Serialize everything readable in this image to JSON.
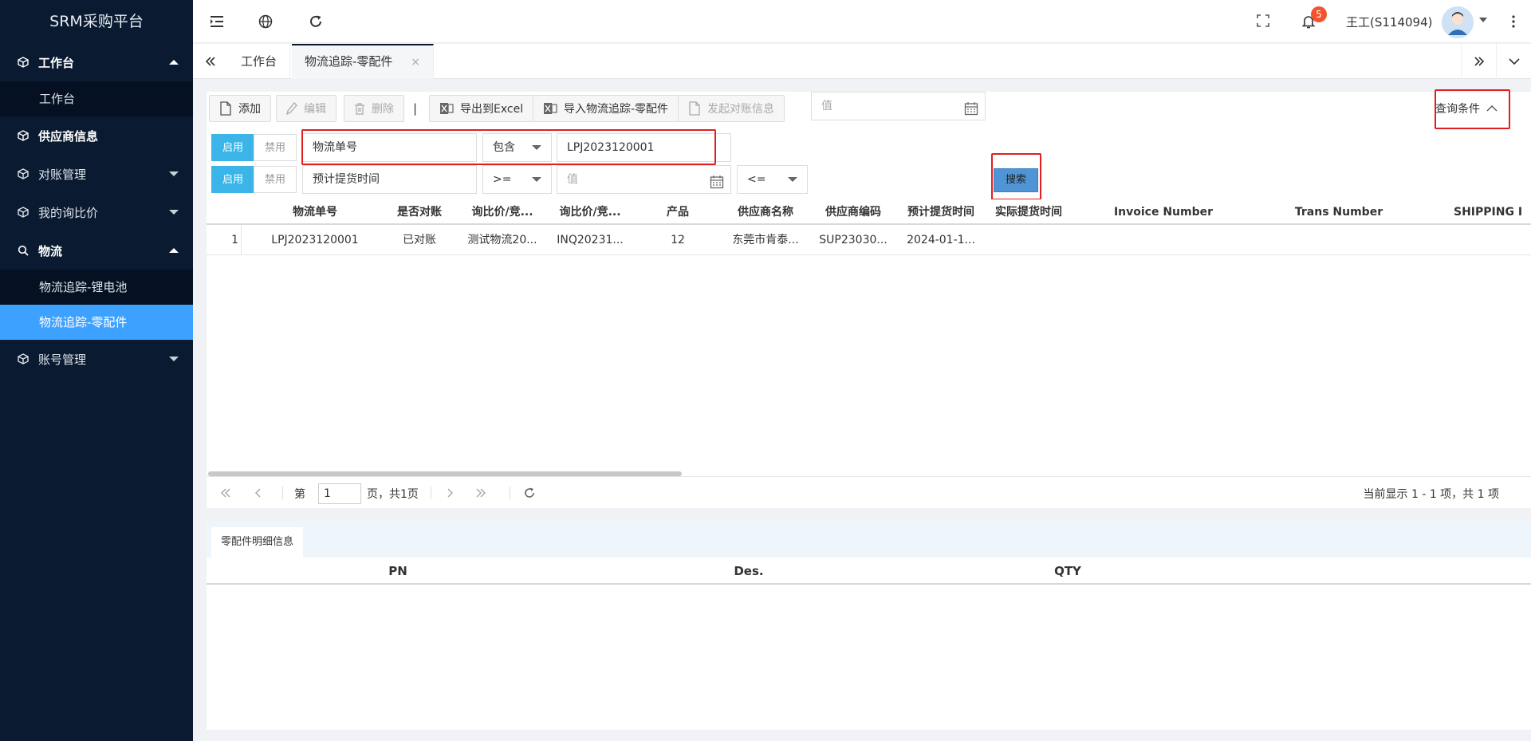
{
  "app": {
    "title": "SRM采购平台"
  },
  "sidebar": {
    "items": [
      {
        "label": "工作台",
        "icon": "cube-icon",
        "expanded": true,
        "children": [
          "工作台"
        ]
      },
      {
        "label": "供应商信息",
        "icon": "cube-icon"
      },
      {
        "label": "对账管理",
        "icon": "cube-icon",
        "expanded": false
      },
      {
        "label": "我的询比价",
        "icon": "cube-icon",
        "expanded": false
      },
      {
        "label": "物流",
        "icon": "search-icon",
        "expanded": true,
        "children": [
          "物流追踪-锂电池",
          "物流追踪-零配件"
        ]
      },
      {
        "label": "账号管理",
        "icon": "cube-icon",
        "expanded": false
      }
    ],
    "active_child": "物流追踪-零配件"
  },
  "header": {
    "user": "王工(S114094)",
    "notification_count": "5",
    "icons": [
      "menu-fold-icon",
      "globe-icon",
      "refresh-icon",
      "fullscreen-icon",
      "bell-icon",
      "avatar",
      "more-vertical-icon"
    ]
  },
  "tabs": {
    "items": [
      {
        "label": "工作台"
      },
      {
        "label": "物流追踪-零配件",
        "active": true,
        "close": "×"
      }
    ]
  },
  "toolbar": {
    "add": "添加",
    "edit": "编辑",
    "delete": "删除",
    "separator": "|",
    "export_excel": "导出到Excel",
    "import": "导入物流追踪-零配件",
    "initiate_reconcile": "发起对账信息",
    "query_conditions": "查询条件"
  },
  "filters": {
    "rows": [
      {
        "enable": "启用",
        "disable": "禁用",
        "field": "物流单号",
        "operator": "包含",
        "value": "LPJ2023120001"
      },
      {
        "enable": "启用",
        "disable": "禁用",
        "field": "预计提货时间",
        "operator": ">=",
        "value_placeholder": "值",
        "operator2": "<=",
        "value2_placeholder": "值"
      }
    ],
    "search": "搜索"
  },
  "grid": {
    "columns": [
      "物流单号",
      "是否对账",
      "询比价/竞...",
      "询比价/竞...",
      "产品",
      "供应商名称",
      "供应商编码",
      "预计提货时间",
      "实际提货时间",
      "Invoice Number",
      "Trans Number",
      "SHIPPING I"
    ],
    "rows": [
      {
        "num": "1",
        "cells": [
          "LPJ2023120001",
          "已对账",
          "测试物流20...",
          "INQ20231...",
          "12",
          "东莞市肯泰...",
          "SUP23030...",
          "2024-01-1...",
          "",
          "",
          "",
          ""
        ]
      }
    ]
  },
  "pager": {
    "page_label_prefix": "第",
    "page_value": "1",
    "page_label_suffix": "页，共1页",
    "info": "当前显示 1 - 1 项，共 1 项"
  },
  "detail": {
    "tab": "零配件明细信息",
    "columns": [
      "PN",
      "Des.",
      "QTY"
    ]
  },
  "colors": {
    "sidebar_bg": "#0a1a30",
    "active_menu": "#3da2ff",
    "enable_btn": "#3bb5e8",
    "search_btn": "#4f94d4",
    "highlight_box": "#e02020",
    "badge": "#f5532e"
  }
}
